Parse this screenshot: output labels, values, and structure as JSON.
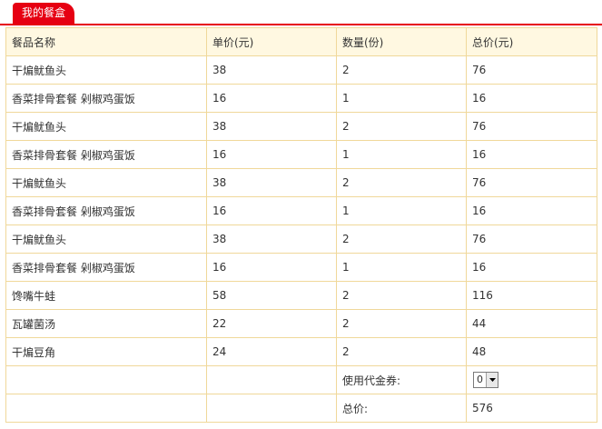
{
  "tab": {
    "label": "我的餐盒"
  },
  "table": {
    "headers": [
      "餐品名称",
      "单价(元)",
      "数量(份)",
      "总价(元)"
    ],
    "rows": [
      [
        "干煸鱿鱼头",
        "38",
        "2",
        "76"
      ],
      [
        "香菜排骨套餐 剁椒鸡蛋饭",
        "16",
        "1",
        "16"
      ],
      [
        "干煸鱿鱼头",
        "38",
        "2",
        "76"
      ],
      [
        "香菜排骨套餐 剁椒鸡蛋饭",
        "16",
        "1",
        "16"
      ],
      [
        "干煸鱿鱼头",
        "38",
        "2",
        "76"
      ],
      [
        "香菜排骨套餐 剁椒鸡蛋饭",
        "16",
        "1",
        "16"
      ],
      [
        "干煸鱿鱼头",
        "38",
        "2",
        "76"
      ],
      [
        "香菜排骨套餐 剁椒鸡蛋饭",
        "16",
        "1",
        "16"
      ],
      [
        "馋嘴牛蛙",
        "58",
        "2",
        "116"
      ],
      [
        "瓦罐菌汤",
        "22",
        "2",
        "44"
      ],
      [
        "干煸豆角",
        "24",
        "2",
        "48"
      ]
    ]
  },
  "voucher": {
    "label": "使用代金券:",
    "selected": "0",
    "arrow_icon": "chevron-down-icon"
  },
  "total": {
    "label": "总价:",
    "value": "576"
  },
  "colors": {
    "accent": "#e60012",
    "border": "#f0d89a",
    "header_bg": "#fff8e1"
  }
}
